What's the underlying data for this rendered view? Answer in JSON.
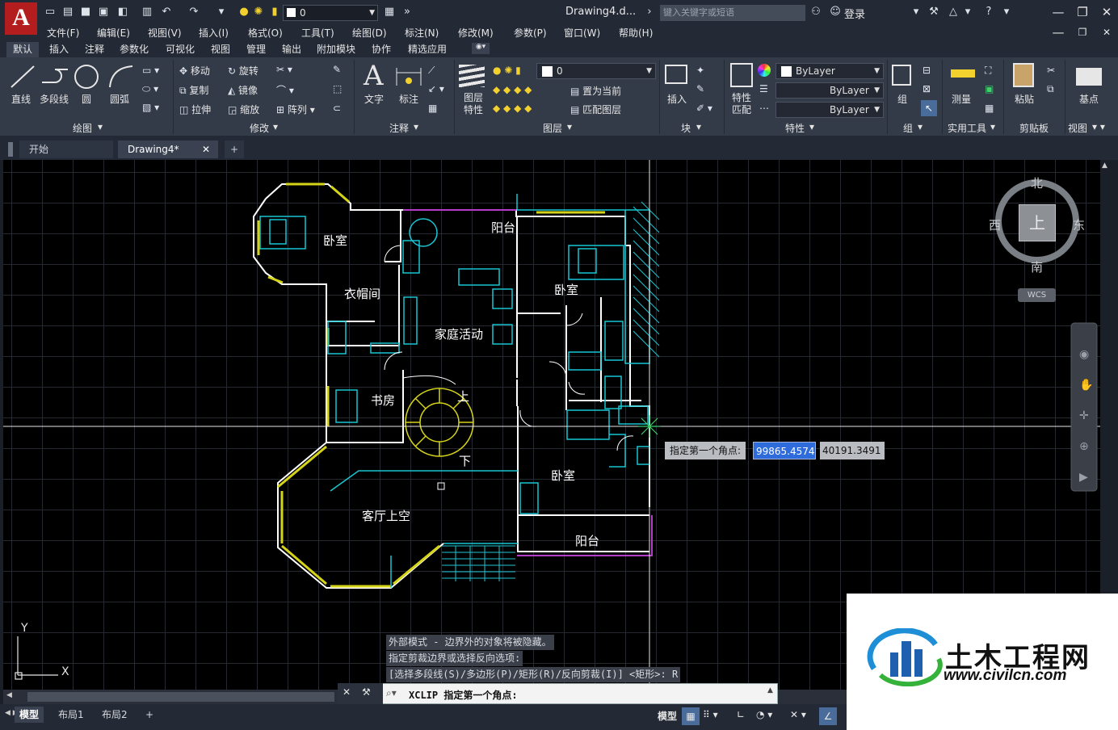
{
  "app": {
    "logo_letter": "A",
    "doc_title": "Drawing4.d...",
    "search_placeholder": "键入关键字或短语",
    "login": "登录",
    "quick_layer": "0"
  },
  "menu": [
    "文件(F)",
    "编辑(E)",
    "视图(V)",
    "插入(I)",
    "格式(O)",
    "工具(T)",
    "绘图(D)",
    "标注(N)",
    "修改(M)",
    "参数(P)",
    "窗口(W)",
    "帮助(H)"
  ],
  "ribbon_tabs": [
    "默认",
    "插入",
    "注释",
    "参数化",
    "可视化",
    "视图",
    "管理",
    "输出",
    "附加模块",
    "协作",
    "精选应用"
  ],
  "ribbon": {
    "draw": {
      "line": "直线",
      "polyline": "多段线",
      "circle": "圆",
      "arc": "圆弧",
      "title": "绘图"
    },
    "modify": {
      "move": "移动",
      "rotate": "旋转",
      "copy": "复制",
      "mirror": "镜像",
      "stretch": "拉伸",
      "scale": "缩放",
      "array": "阵列",
      "title": "修改"
    },
    "annotation": {
      "text": "文字",
      "dimension": "标注",
      "title": "注释"
    },
    "layers": {
      "props": "图层\n特性",
      "layer_name": "0",
      "set_current": "置为当前",
      "match_layer": "匹配图层",
      "title": "图层"
    },
    "block": {
      "insert": "插入",
      "title": "块"
    },
    "properties": {
      "match": "特性\n匹配",
      "bylayer1": "ByLayer",
      "bylayer2": "ByLayer",
      "bylayer3": "ByLayer",
      "title": "特性"
    },
    "groups": {
      "group": "组",
      "title": "组"
    },
    "utilities": {
      "measure": "测量",
      "title": "实用工具"
    },
    "clipboard": {
      "paste": "粘贴",
      "title": "剪贴板"
    },
    "view": {
      "base": "基点",
      "title": "视图"
    }
  },
  "file_tabs": {
    "start": "开始",
    "drawing": "Drawing4*",
    "add": "+"
  },
  "viewcube": {
    "north": "北",
    "south": "南",
    "west": "西",
    "east": "东",
    "top": "上",
    "wcs": "WCS"
  },
  "rooms": {
    "bedroom1": "卧室",
    "balcony1": "阳台",
    "bedroom2": "卧室",
    "wardrobe": "衣帽间",
    "family": "家庭活动",
    "study": "书房",
    "up": "上",
    "down": "下",
    "bedroom3": "卧室",
    "living": "客厅上空",
    "balcony2": "阳台"
  },
  "tooltip": {
    "label": "指定第一个角点:",
    "x": "99865.4574",
    "y": "40191.3491"
  },
  "command": {
    "history": [
      "外部模式 - 边界外的对象将被隐藏。",
      "指定剪裁边界或选择反向选项:",
      "[选择多段线(S)/多边形(P)/矩形(R)/反向剪裁(I)] <矩形>: R"
    ],
    "prompt": "XCLIP 指定第一个角点:"
  },
  "layout_tabs": [
    "模型",
    "布局1",
    "布局2"
  ],
  "status": {
    "model": "模型"
  },
  "watermark": {
    "name": "土木工程网",
    "url": "www.civilcn.com"
  },
  "colors": {
    "accent": "#1e8fd6",
    "cyan": "#19c6d4",
    "yellow": "#d6d419",
    "magenta": "#b43cc8",
    "wall": "#ffffff"
  }
}
